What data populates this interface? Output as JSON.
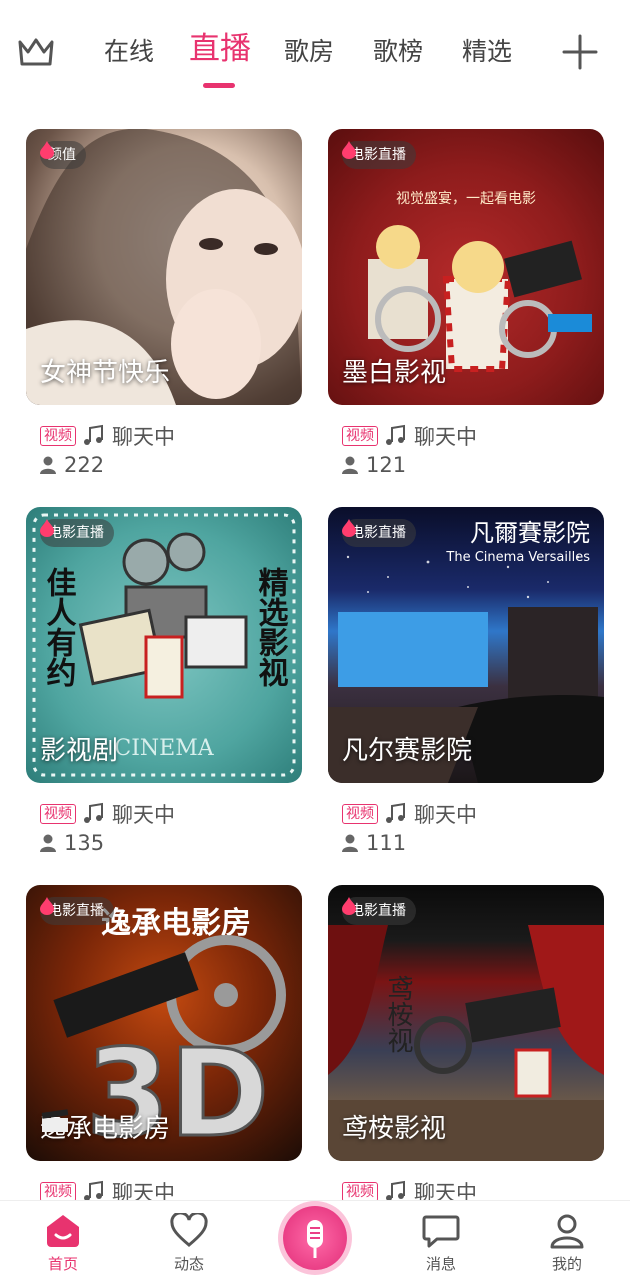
{
  "topnav": {
    "tabs": [
      {
        "label": "在线"
      },
      {
        "label": "直播"
      },
      {
        "label": "歌房"
      },
      {
        "label": "歌榜"
      },
      {
        "label": "精选"
      }
    ],
    "active_tab": "直播",
    "accent_color": "#e8336f"
  },
  "rooms": [
    {
      "badge": "颜值",
      "title": "女神节快乐",
      "tag": "视频",
      "status": "聊天中",
      "viewers": "222"
    },
    {
      "badge": "电影直播",
      "title": "墨白影视",
      "tag": "视频",
      "status": "聊天中",
      "viewers": "121"
    },
    {
      "badge": "电影直播",
      "title": "影视剧",
      "tag": "视频",
      "status": "聊天中",
      "viewers": "135"
    },
    {
      "badge": "电影直播",
      "title": "凡尔赛影院",
      "tag": "视频",
      "status": "聊天中",
      "viewers": "111"
    },
    {
      "badge": "电影直播",
      "title": "逸承电影房",
      "tag": "视频",
      "status": "聊天中",
      "viewers": ""
    },
    {
      "badge": "电影直播",
      "title": "鸢桉影视",
      "tag": "视频",
      "status": "聊天中",
      "viewers": ""
    }
  ],
  "thumb_text": {
    "room2_banner": "视觉盛宴，一起看电影",
    "room3_left": "佳人有约",
    "room3_right": "精选影视",
    "room3_bottom": "CINEMA",
    "room4_name": "凡爾賽影院",
    "room4_sub": "The Cinema Versailles",
    "room5_top": "逸承电影房",
    "room5_big": "3D",
    "room6_vertical": "鸢桉视"
  },
  "bottom_nav": {
    "items": [
      {
        "label": "首页",
        "icon": "home-icon"
      },
      {
        "label": "动态",
        "icon": "heart-icon"
      },
      {
        "label": "",
        "icon": "microphone-icon"
      },
      {
        "label": "消息",
        "icon": "message-icon"
      },
      {
        "label": "我的",
        "icon": "user-icon"
      }
    ]
  }
}
